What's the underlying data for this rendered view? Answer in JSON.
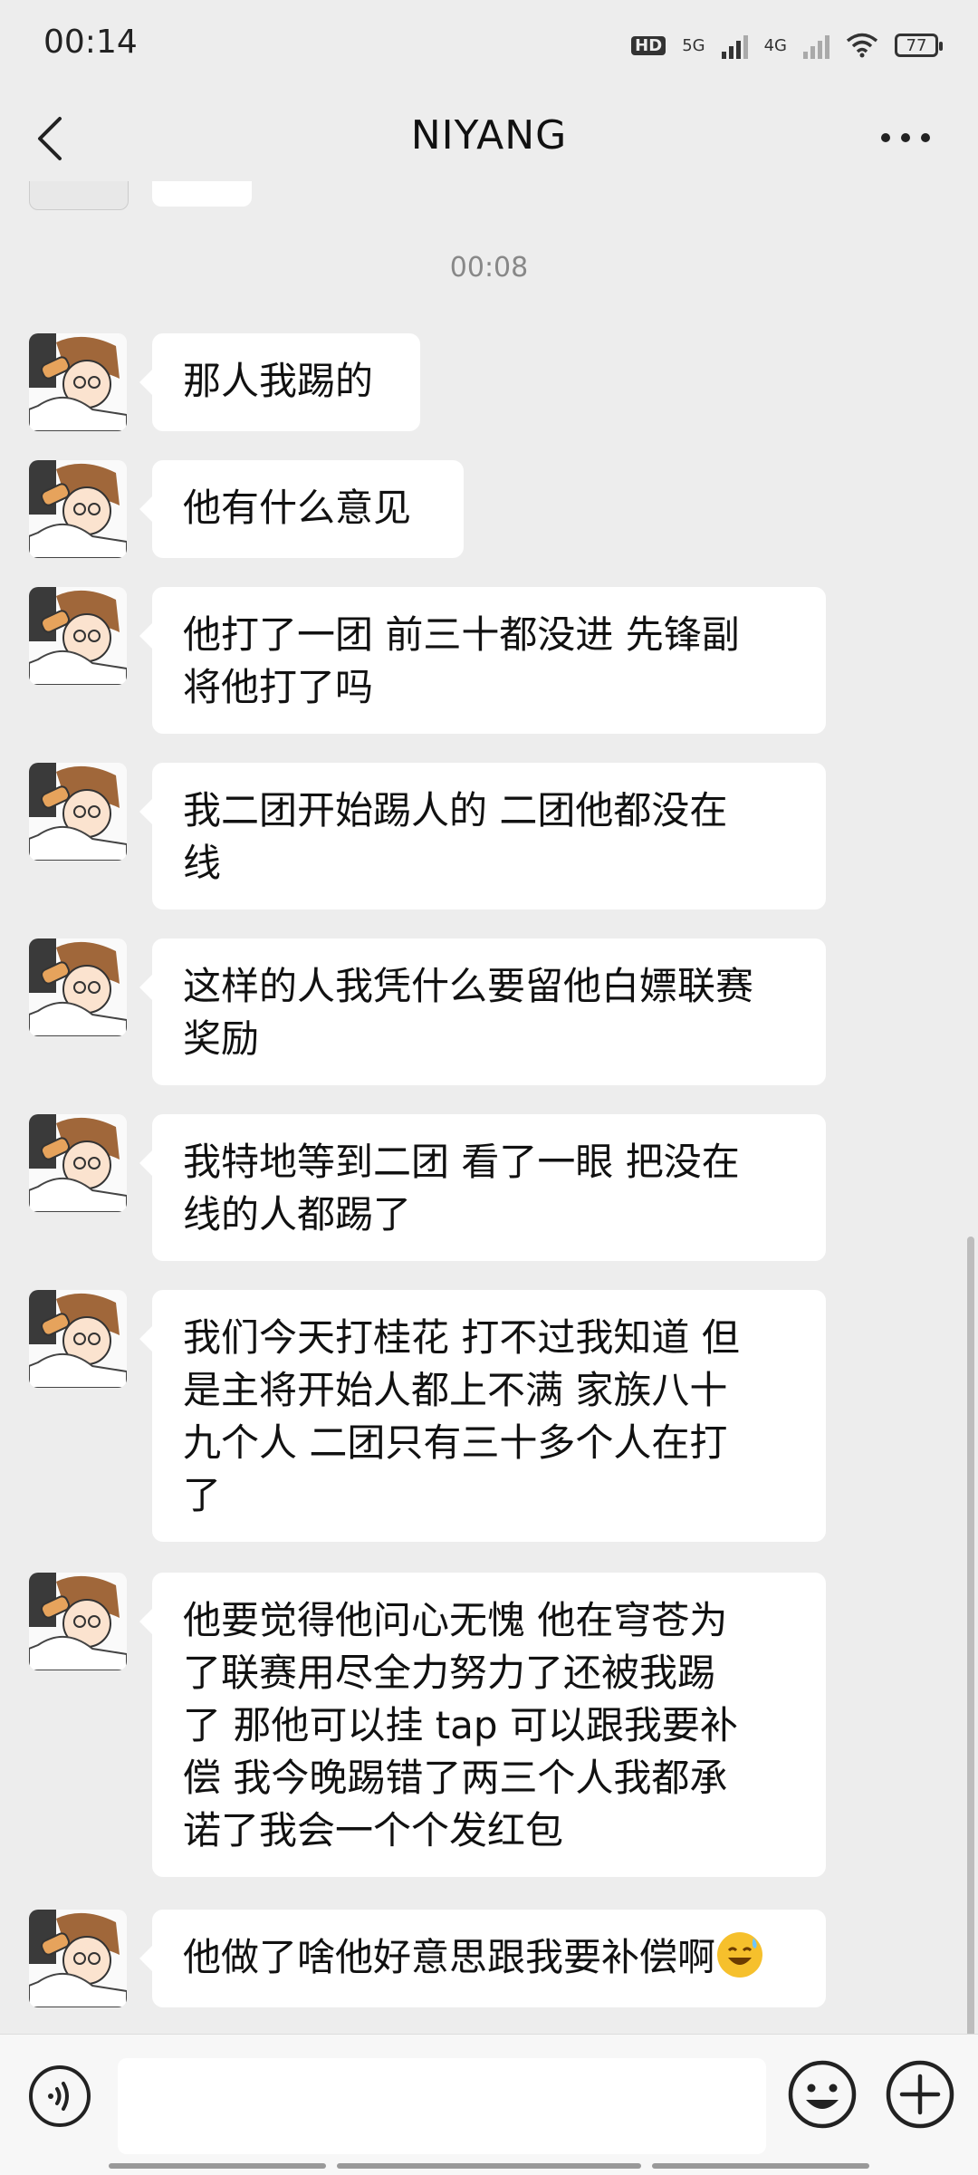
{
  "status_bar": {
    "time": "00:14",
    "hd": "HD",
    "net1": "5G",
    "net2": "4G",
    "battery": "77"
  },
  "nav": {
    "title": "NIYANG",
    "back_icon": "chevron-left-icon",
    "more_icon": "more-dots-icon"
  },
  "chat": {
    "timestamp": "00:08",
    "messages": [
      {
        "text": "那人我踢的"
      },
      {
        "text": "他有什么意见"
      },
      {
        "text": "他打了一团 前三十都没进 先锋副\n将他打了吗"
      },
      {
        "text": "我二团开始踢人的 二团他都没在\n线"
      },
      {
        "text": "这样的人我凭什么要留他白嫖联赛\n奖励"
      },
      {
        "text": "我特地等到二团 看了一眼 把没在\n线的人都踢了"
      },
      {
        "text": "我们今天打桂花 打不过我知道 但\n是主将开始人都上不满 家族八十\n九个人 二团只有三十多个人在打\n了"
      },
      {
        "text": "他要觉得他问心无愧 他在穹苍为\n了联赛用尽全力努力了还被我踢\n了 那他可以挂 tap 可以跟我要补\n偿 我今晚踢错了两三个人我都承\n诺了我会一个个发红包"
      },
      {
        "text": "他做了啥他好意思跟我要补偿啊",
        "emoji": "sweat-smile-emoji"
      }
    ]
  },
  "input_bar": {
    "voice_icon": "voice-icon",
    "emoji_icon": "emoji-icon",
    "plus_icon": "plus-icon",
    "input_value": ""
  }
}
